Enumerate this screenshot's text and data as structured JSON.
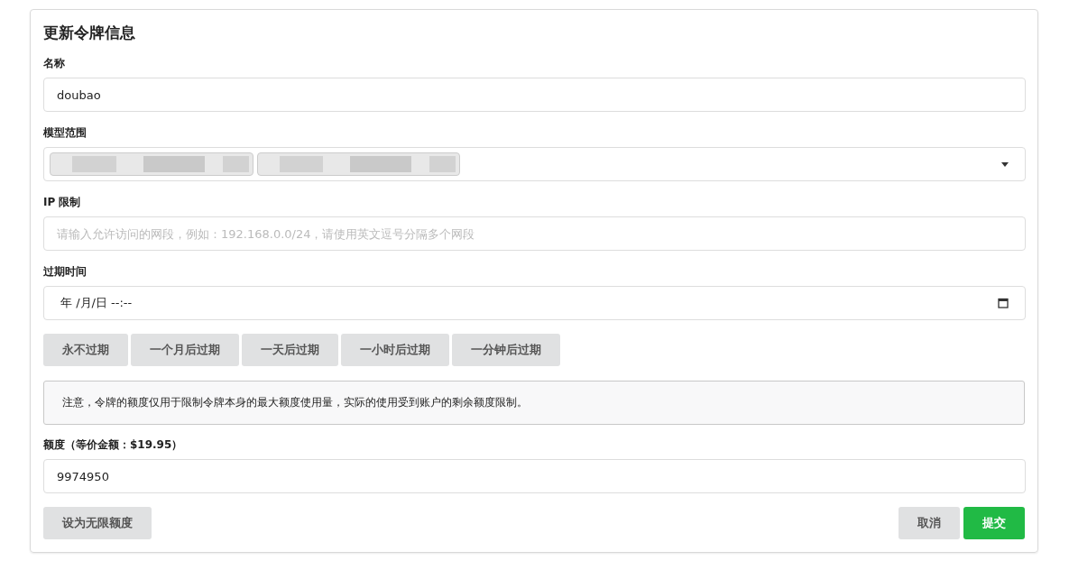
{
  "title": "更新令牌信息",
  "name_field": {
    "label": "名称",
    "value": "doubao"
  },
  "model_range": {
    "label": "模型范围",
    "chips": [
      {
        "kind": "redacted"
      },
      {
        "kind": "redacted"
      }
    ]
  },
  "ip_limit": {
    "label": "IP 限制",
    "placeholder": "请输入允许访问的网段，例如：192.168.0.0/24，请使用英文逗号分隔多个网段"
  },
  "expiry": {
    "label": "过期时间",
    "value": "年 /月/日 --:--"
  },
  "expiry_buttons": [
    "永不过期",
    "一个月后过期",
    "一天后过期",
    "一小时后过期",
    "一分钟后过期"
  ],
  "notice": "注意，令牌的额度仅用于限制令牌本身的最大额度使用量，实际的使用受到账户的剩余额度限制。",
  "quota": {
    "label": "额度（等价金额：$19.95）",
    "value": "9974950"
  },
  "footer_buttons": [
    {
      "label": "设为无限额度",
      "kind": "secondary"
    },
    {
      "label": "取消",
      "kind": "secondary"
    },
    {
      "label": "提交",
      "kind": "primary"
    }
  ]
}
